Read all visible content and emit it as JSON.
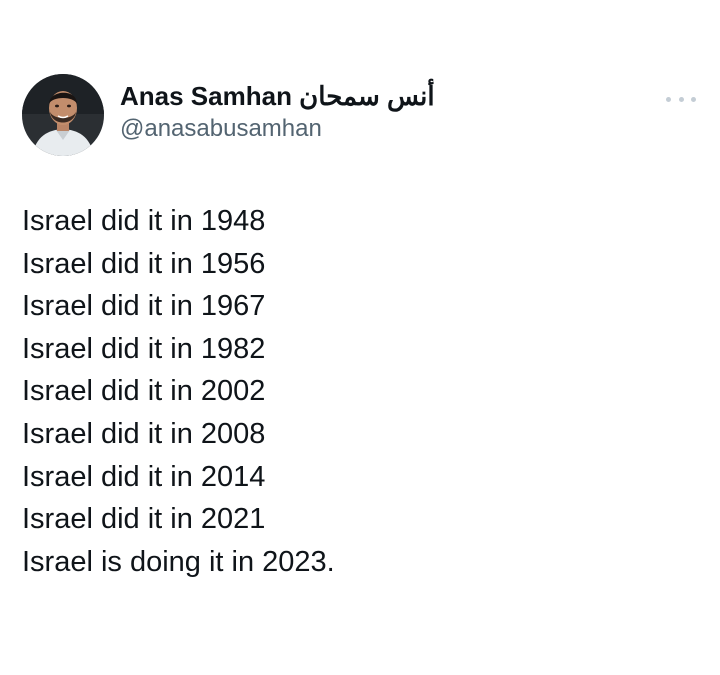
{
  "author": {
    "display_name": "Anas Samhan أنس سمحان",
    "handle": "@anasabusamhan",
    "avatar_icon": "profile-photo"
  },
  "menu": {
    "icon": "more-options-icon"
  },
  "tweet": {
    "lines": [
      "Israel did it in 1948",
      "Israel did it in 1956",
      "Israel did it in 1967",
      "Israel did it in 1982",
      "Israel did it in 2002",
      "Israel did it in 2008",
      "Israel did it in 2014",
      "Israel did it in 2021",
      "Israel is doing it in 2023."
    ]
  },
  "colors": {
    "text": "#0f1419",
    "secondary_text": "#536471",
    "background": "#ffffff",
    "menu_dots": "#c4cdd5"
  }
}
